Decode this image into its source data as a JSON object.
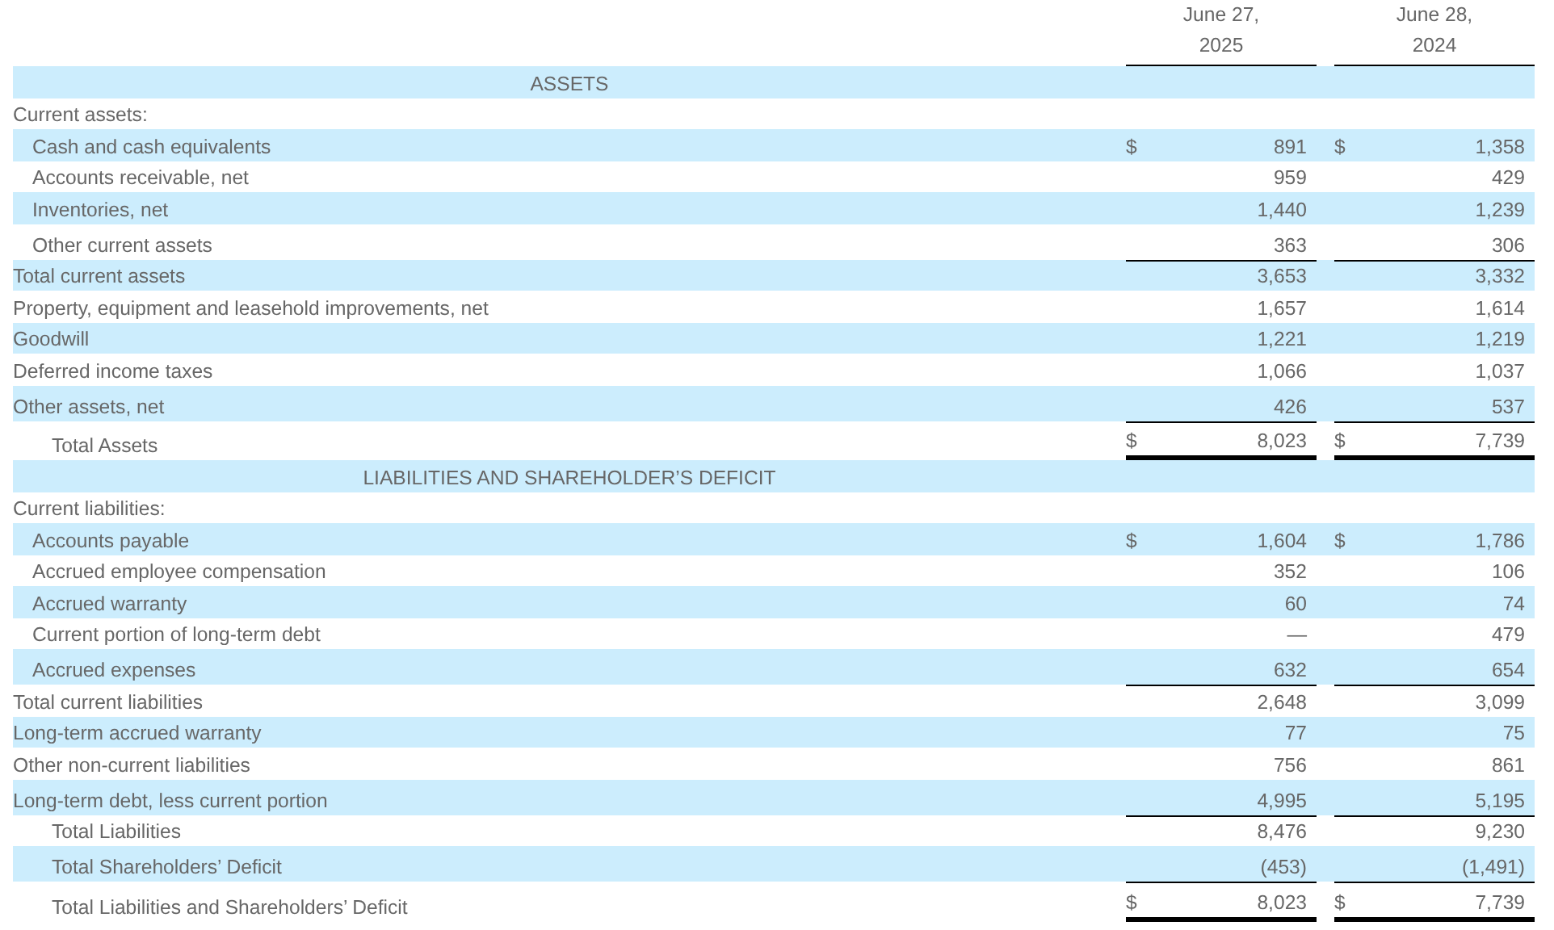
{
  "columns": [
    {
      "label": "June 27,\n2025"
    },
    {
      "label": "June 28,\n2024"
    }
  ],
  "rows": [
    {
      "kind": "section",
      "label": "ASSETS"
    },
    {
      "kind": "group",
      "label": "Current assets:",
      "children": [
        {
          "kind": "line",
          "label": "Cash and cash equivalents",
          "values": [
            {
              "sign": "$",
              "amount": "891"
            },
            {
              "sign": "$",
              "amount": "1,358"
            }
          ]
        },
        {
          "kind": "line",
          "label": "Accounts receivable, net",
          "values": [
            {
              "amount": "959"
            },
            {
              "amount": "429"
            }
          ]
        },
        {
          "kind": "line",
          "label": "Inventories, net",
          "values": [
            {
              "amount": "1,440"
            },
            {
              "amount": "1,239"
            }
          ]
        },
        {
          "kind": "line",
          "label": "Other current assets",
          "values": [
            {
              "amount": "363"
            },
            {
              "amount": "306"
            }
          ]
        }
      ]
    },
    {
      "kind": "line",
      "label": "Total current assets",
      "rule_above": true,
      "values": [
        {
          "amount": "3,653"
        },
        {
          "amount": "3,332"
        }
      ]
    },
    {
      "kind": "line",
      "label": "Property, equipment and leasehold improvements, net",
      "values": [
        {
          "amount": "1,657"
        },
        {
          "amount": "1,614"
        }
      ]
    },
    {
      "kind": "line",
      "label": "Goodwill",
      "values": [
        {
          "amount": "1,221"
        },
        {
          "amount": "1,219"
        }
      ]
    },
    {
      "kind": "line",
      "label": "Deferred income taxes",
      "values": [
        {
          "amount": "1,066"
        },
        {
          "amount": "1,037"
        }
      ]
    },
    {
      "kind": "line",
      "label": "Other assets, net",
      "values": [
        {
          "amount": "426"
        },
        {
          "amount": "537"
        }
      ]
    },
    {
      "kind": "total",
      "label": "Total Assets",
      "rule_above": true,
      "rule_below": true,
      "values": [
        {
          "sign": "$",
          "amount": "8,023"
        },
        {
          "sign": "$",
          "amount": "7,739"
        }
      ]
    },
    {
      "kind": "section",
      "label": "LIABILITIES AND SHAREHOLDER’S DEFICIT"
    },
    {
      "kind": "group",
      "label": "Current liabilities:",
      "children": [
        {
          "kind": "line",
          "label": "Accounts payable",
          "values": [
            {
              "sign": "$",
              "amount": "1,604"
            },
            {
              "sign": "$",
              "amount": "1,786"
            }
          ]
        },
        {
          "kind": "line",
          "label": "Accrued employee compensation",
          "values": [
            {
              "amount": "352"
            },
            {
              "amount": "106"
            }
          ]
        },
        {
          "kind": "line",
          "label": "Accrued warranty",
          "values": [
            {
              "amount": "60"
            },
            {
              "amount": "74"
            }
          ]
        },
        {
          "kind": "line",
          "label": "Current portion of long-term debt",
          "values": [
            {
              "amount": "—"
            },
            {
              "amount": "479"
            }
          ]
        },
        {
          "kind": "line",
          "label": "Accrued expenses",
          "values": [
            {
              "amount": "632"
            },
            {
              "amount": "654"
            }
          ]
        }
      ]
    },
    {
      "kind": "line",
      "label": "Total current liabilities",
      "rule_above": true,
      "values": [
        {
          "amount": "2,648"
        },
        {
          "amount": "3,099"
        }
      ]
    },
    {
      "kind": "line",
      "label": "Long-term accrued warranty",
      "values": [
        {
          "amount": "77"
        },
        {
          "amount": "75"
        }
      ]
    },
    {
      "kind": "line",
      "label": "Other non-current liabilities",
      "values": [
        {
          "amount": "756"
        },
        {
          "amount": "861"
        }
      ]
    },
    {
      "kind": "line",
      "label": "Long-term debt, less current portion",
      "values": [
        {
          "amount": "4,995"
        },
        {
          "amount": "5,195"
        }
      ]
    },
    {
      "kind": "total",
      "label": "Total Liabilities",
      "rule_above": true,
      "values": [
        {
          "amount": "8,476"
        },
        {
          "amount": "9,230"
        }
      ]
    },
    {
      "kind": "total",
      "label": "Total Shareholders’ Deficit",
      "values": [
        {
          "amount": "(453)"
        },
        {
          "amount": "(1,491)"
        }
      ]
    },
    {
      "kind": "total",
      "label": "Total Liabilities and Shareholders’ Deficit",
      "rule_above": true,
      "rule_below": true,
      "values": [
        {
          "sign": "$",
          "amount": "8,023"
        },
        {
          "sign": "$",
          "amount": "7,739"
        }
      ]
    }
  ]
}
